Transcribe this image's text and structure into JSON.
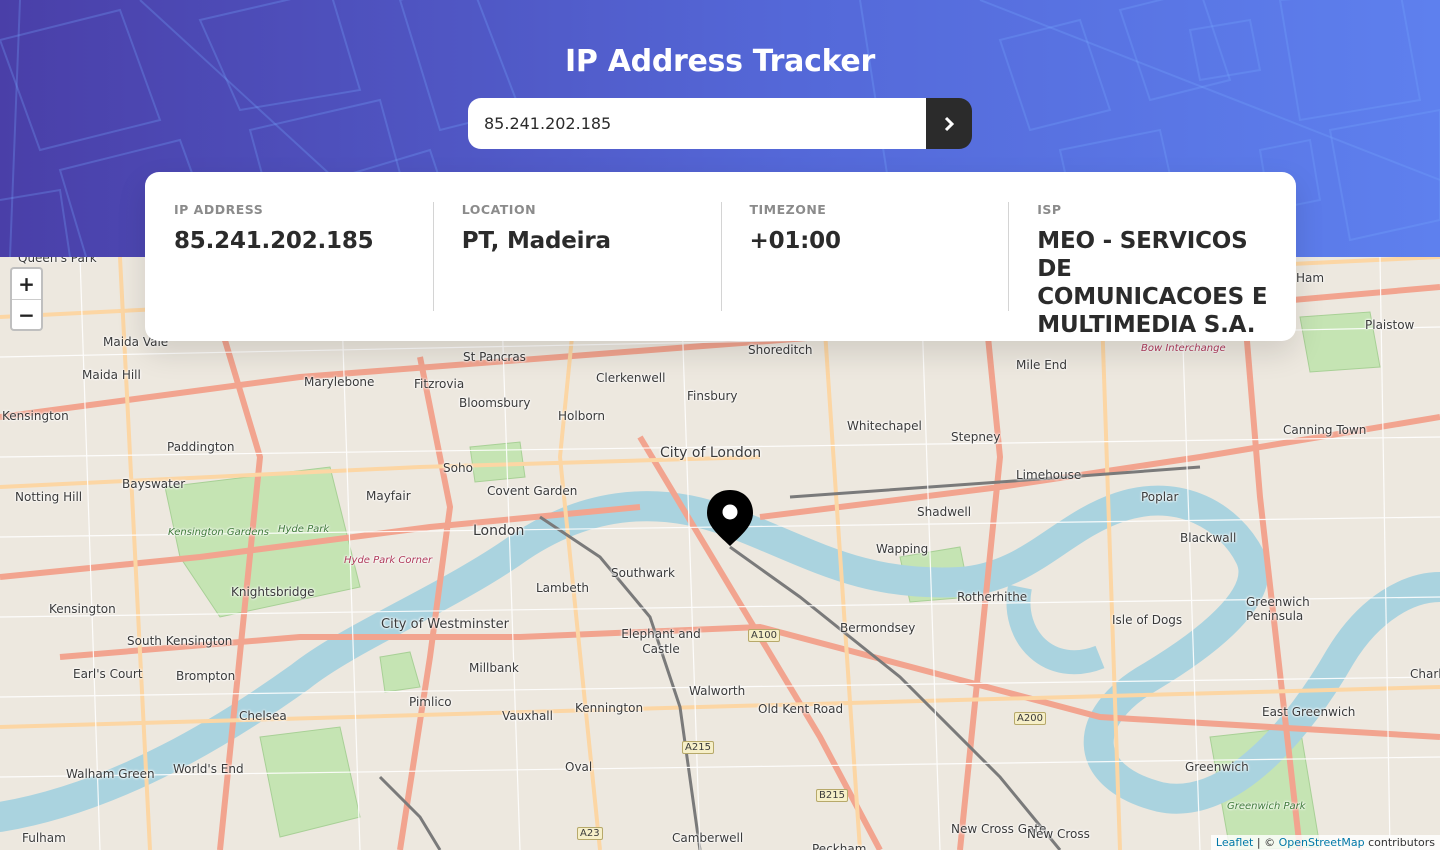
{
  "header": {
    "title": "IP Address Tracker",
    "search_value": "85.241.202.185",
    "submit_icon": "chevron-right-icon"
  },
  "info": {
    "ip": {
      "label": "IP ADDRESS",
      "value": "85.241.202.185"
    },
    "location": {
      "label": "LOCATION",
      "value": "PT, Madeira"
    },
    "timezone": {
      "label": "TIMEZONE",
      "value": "+01:00"
    },
    "isp": {
      "label": "ISP",
      "value": "MEO - SERVICOS DE COMUNICACOES E MULTIMEDIA S.A."
    }
  },
  "map": {
    "zoom_in": "+",
    "zoom_out": "−",
    "marker_icon": "location-pin-icon",
    "attribution": {
      "leaflet": "Leaflet",
      "separator": " | © ",
      "osm": "OpenStreetMap",
      "suffix": " contributors"
    },
    "places": [
      "Queen's Park",
      "Maida Vale",
      "Maida Hill",
      "Kensington",
      "Paddington",
      "Bayswater",
      "Notting Hill",
      "Marylebone",
      "Fitzrovia",
      "St Pancras",
      "Bloomsbury",
      "Clerkenwell",
      "Holborn",
      "Finsbury",
      "Shoreditch",
      "Mile End",
      "Plaistow",
      "Whitechapel",
      "Stepney",
      "Canning Town",
      "Limehouse",
      "City of London",
      "Soho",
      "Covent Garden",
      "Mayfair",
      "London",
      "Hyde Park",
      "Kensington Gardens",
      "Hyde Park Corner",
      "Knightsbridge",
      "Shadwell",
      "Wapping",
      "Poplar",
      "Blackwall",
      "Southwark",
      "Lambeth",
      "Rotherhithe",
      "Isle of Dogs",
      "Greenwich Peninsula",
      "Kensington",
      "South Kensington",
      "City of Westminster",
      "Elephant and Castle",
      "Bermondsey",
      "Earl's Court",
      "Brompton",
      "Millbank",
      "Pimlico",
      "Walworth",
      "Chelsea",
      "Vauxhall",
      "Kennington",
      "Old Kent Road",
      "East Greenwich",
      "Walham Green",
      "World's End",
      "Oval",
      "Greenwich",
      "Fulham",
      "Camberwell",
      "New Cross Gate",
      "New Cross",
      "Peckham",
      "Greenwich Park",
      "Bow Interchange",
      "Ham",
      "Charl"
    ],
    "roads": [
      "A100",
      "A200",
      "A215",
      "B215",
      "A23"
    ]
  }
}
